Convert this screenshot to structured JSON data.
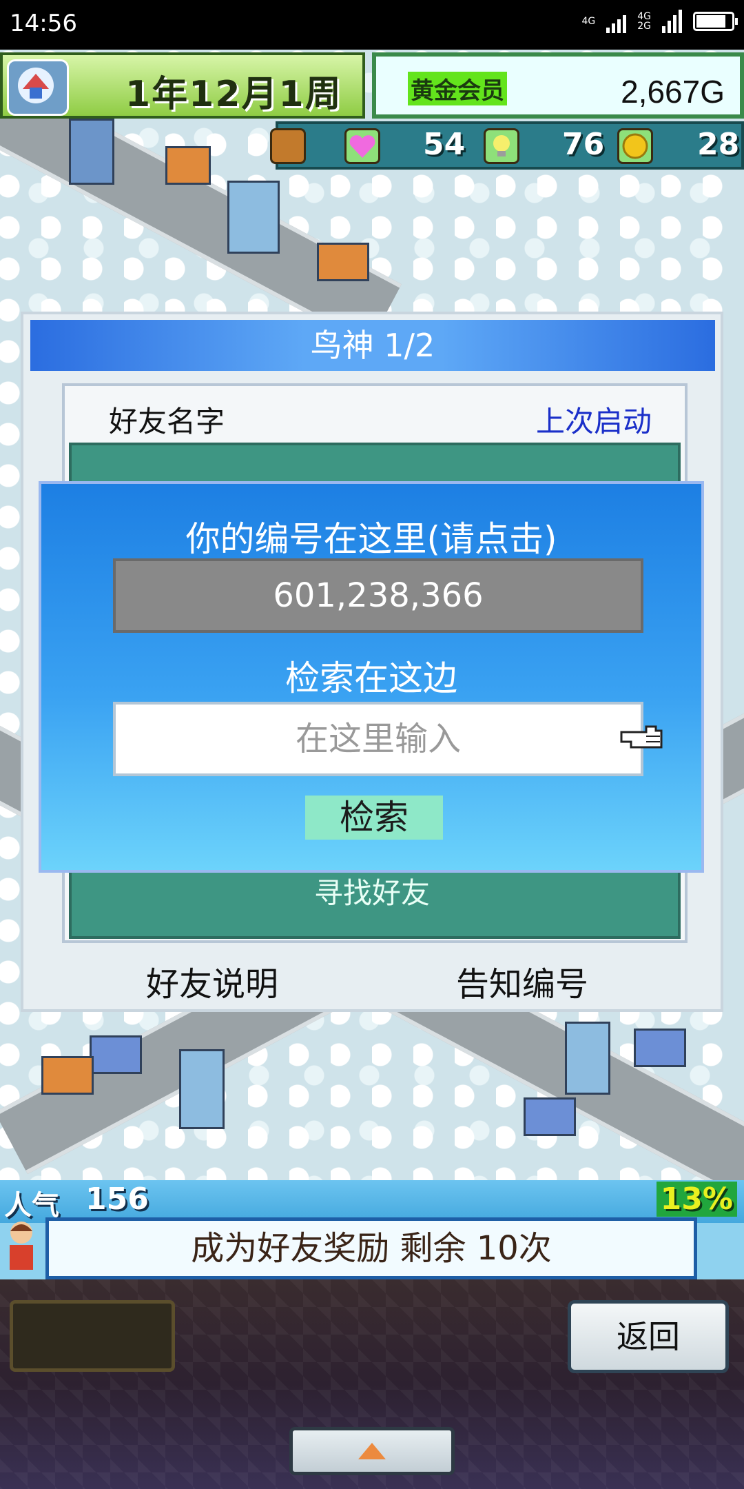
{
  "status_bar": {
    "time": "14:56",
    "network_top": "4G",
    "network_2g_top": "4G",
    "network_2g_bottom": "2G"
  },
  "hud": {
    "date_text": "1年12月1周",
    "member_label": "黄金会员",
    "money": "2,667G",
    "stats": {
      "hearts": "54",
      "ideas": "76",
      "coins": "28"
    }
  },
  "friend_dialog": {
    "title": "鸟神 1/2",
    "col_name": "好友名字",
    "col_last_launch": "上次启动",
    "find_friend": "寻找好友",
    "friend_explain": "好友说明",
    "tell_id": "告知编号"
  },
  "search_panel": {
    "title": "你的编号在这里(请点击)",
    "id_value": "601,238,366",
    "subtitle": "检索在这边",
    "input_placeholder": "在这里输入",
    "search_button": "检索"
  },
  "bottom": {
    "popularity_label": "人气",
    "popularity_value": "156",
    "percent": "13%",
    "reward_text": "成为好友奖励 剩余 10次",
    "back_button": "返回"
  },
  "icons": {
    "hud_logo": "game-logo-icon",
    "chest": "treasure-chest-icon",
    "heart": "heart-icon",
    "bulb": "lightbulb-icon",
    "coin": "coin-icon",
    "pointer": "pointing-hand-icon",
    "avatar": "character-avatar-icon",
    "arrow": "arrow-up-icon"
  }
}
